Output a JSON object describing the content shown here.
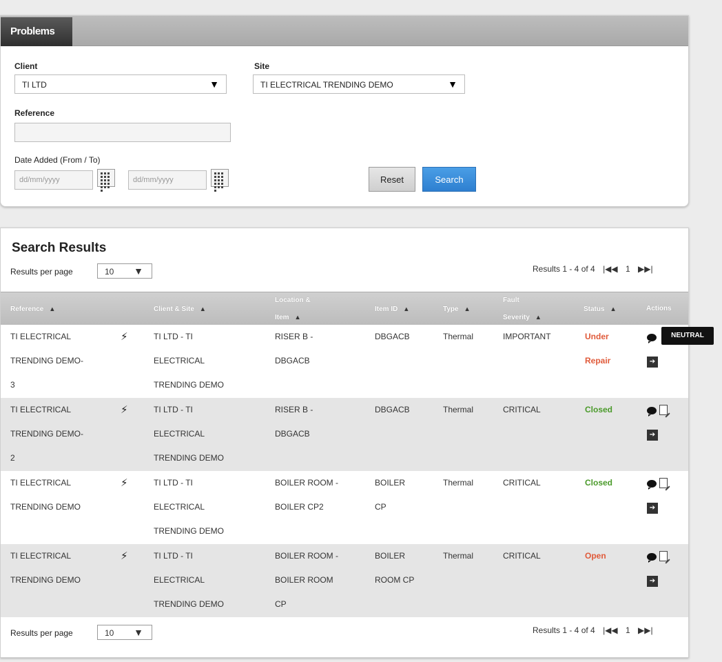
{
  "problems_tab": {
    "label": "Problems"
  },
  "form": {
    "client_label": "Client",
    "client_value": "TI LTD",
    "site_label": "Site",
    "site_value": "TI ELECTRICAL TRENDING DEMO",
    "reference_label": "Reference",
    "reference_value": "",
    "date_label": "Date Added (From / To)",
    "date_from_placeholder": "dd/mm/yyyy",
    "date_to_placeholder": "dd/mm/yyyy",
    "reset_label": "Reset",
    "search_label": "Search"
  },
  "results": {
    "title": "Search Results",
    "rpp_label": "Results per page",
    "rpp_value": "10",
    "summary": "Results 1 - 4 of 4",
    "page_number": "1",
    "first_icon": "first-page-icon",
    "prev_icon": "prev-page-icon",
    "next_icon": "next-page-icon",
    "last_icon": "last-page-icon"
  },
  "columns": {
    "reference": "Reference",
    "client_site": "Client & Site",
    "location_line1": "Location &",
    "location_line2": "Item",
    "item_id": "Item ID",
    "type": "Type",
    "fault_line1": "Fault",
    "fault_line2": "Severity",
    "status": "Status",
    "actions": "Actions",
    "sort_glyph": "▲"
  },
  "rows": [
    {
      "ref": [
        "TI ELECTRICAL",
        "TRENDING DEMO-",
        "3"
      ],
      "client_site": [
        "TI LTD - TI",
        "ELECTRICAL",
        "TRENDING DEMO"
      ],
      "location": [
        "RISER B -",
        "DBGACB"
      ],
      "item_id": [
        "DBGACB"
      ],
      "type": "Thermal",
      "severity": "IMPORTANT",
      "status": [
        "Under",
        "Repair"
      ],
      "status_kind": "under"
    },
    {
      "ref": [
        "TI ELECTRICAL",
        "TRENDING DEMO-",
        "2"
      ],
      "client_site": [
        "TI LTD - TI",
        "ELECTRICAL",
        "TRENDING DEMO"
      ],
      "location": [
        "RISER B -",
        "DBGACB"
      ],
      "item_id": [
        "DBGACB"
      ],
      "type": "Thermal",
      "severity": "CRITICAL",
      "status": [
        "Closed"
      ],
      "status_kind": "closed"
    },
    {
      "ref": [
        "TI ELECTRICAL",
        "TRENDING DEMO"
      ],
      "client_site": [
        "TI LTD - TI",
        "ELECTRICAL",
        "TRENDING DEMO"
      ],
      "location": [
        "BOILER ROOM -",
        "BOILER CP2"
      ],
      "item_id": [
        "BOILER",
        "CP"
      ],
      "type": "Thermal",
      "severity": "CRITICAL",
      "status": [
        "Closed"
      ],
      "status_kind": "closed"
    },
    {
      "ref": [
        "TI ELECTRICAL",
        "TRENDING DEMO"
      ],
      "client_site": [
        "TI LTD - TI",
        "ELECTRICAL",
        "TRENDING DEMO"
      ],
      "location": [
        "BOILER ROOM -",
        "BOILER ROOM",
        "CP"
      ],
      "item_id": [
        "BOILER",
        "ROOM CP"
      ],
      "type": "Thermal",
      "severity": "CRITICAL",
      "status": [
        "Open"
      ],
      "status_kind": "open"
    }
  ],
  "tooltip": {
    "text": "NEUTRAL"
  },
  "icons": {
    "dropdown": "▼",
    "bolt": "⚡",
    "view_arrow": "➔"
  }
}
